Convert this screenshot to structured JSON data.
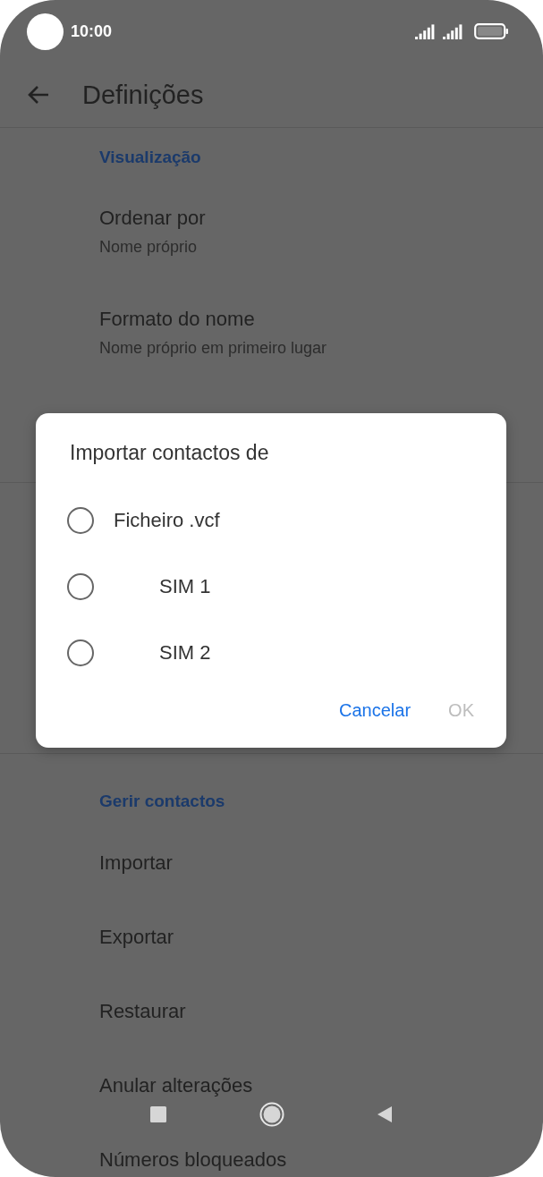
{
  "status_bar": {
    "time": "10:00"
  },
  "app_bar": {
    "title": "Definições"
  },
  "sections": [
    {
      "header": "Visualização",
      "items": [
        {
          "label": "Ordenar por",
          "value": "Nome próprio"
        },
        {
          "label": "Formato do nome",
          "value": "Nome próprio em primeiro lugar"
        }
      ]
    },
    {
      "header": "Gerir contactos",
      "items": [
        {
          "label": "Importar"
        },
        {
          "label": "Exportar"
        },
        {
          "label": "Restaurar"
        },
        {
          "label": "Anular alterações"
        },
        {
          "label": "Números bloqueados"
        }
      ]
    }
  ],
  "dialog": {
    "title": "Importar contactos de",
    "options": [
      {
        "label": "Ficheiro .vcf",
        "kind": "file",
        "selected": false
      },
      {
        "label": "SIM 1",
        "kind": "sim",
        "selected": false
      },
      {
        "label": "SIM 2",
        "kind": "sim",
        "selected": false
      }
    ],
    "buttons": [
      {
        "label": "Cancelar",
        "disabled": false
      },
      {
        "label": "OK",
        "disabled": true
      }
    ]
  }
}
